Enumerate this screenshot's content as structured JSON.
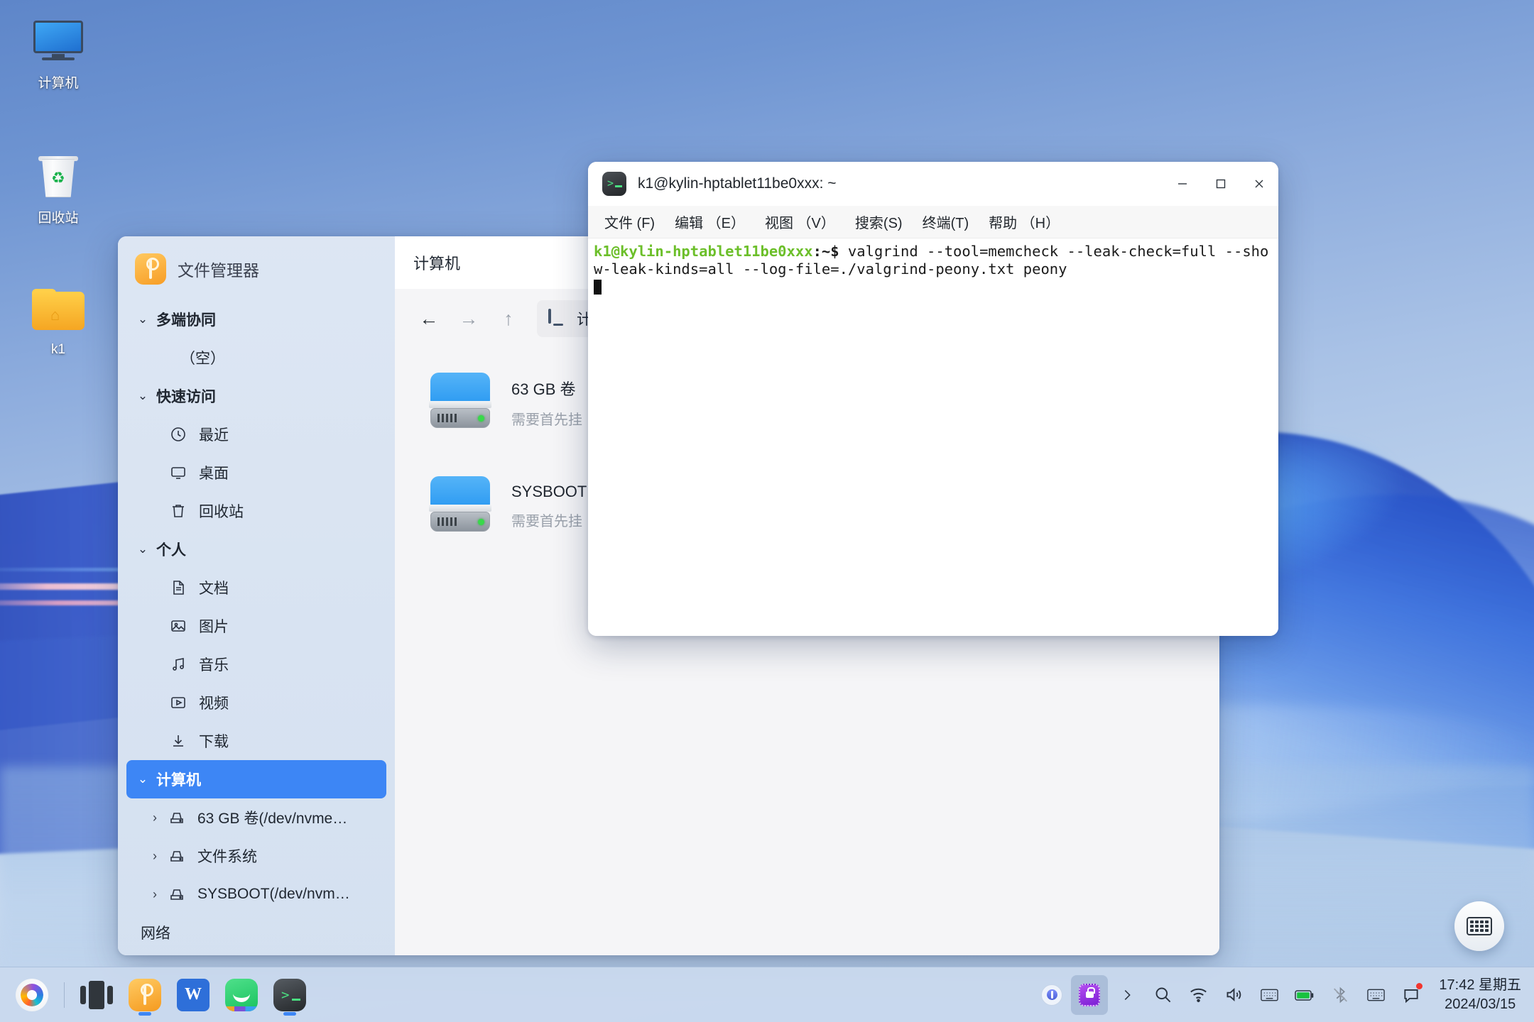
{
  "desktop": {
    "icons": [
      {
        "id": "computer",
        "label": "计算机",
        "icon": "monitor-icon"
      },
      {
        "id": "recycle",
        "label": "回收站",
        "icon": "trash-icon"
      },
      {
        "id": "home",
        "label": "k1",
        "icon": "folder-home-icon"
      }
    ]
  },
  "file_manager": {
    "app_name": "文件管理器",
    "app_icon": "file-manager-icon",
    "tab_title": "计算机",
    "close_label": "✕",
    "toolbar": {
      "back": "←",
      "forward": "→",
      "up": "↑",
      "address_crumb": "计算机",
      "address_icon": "computer-icon"
    },
    "sidebar": {
      "groups": [
        {
          "label": "多端协同",
          "chevron": "⌄",
          "selected": false,
          "items": [
            {
              "label": "（空）",
              "icon": "none",
              "kind": "empty"
            }
          ]
        },
        {
          "label": "快速访问",
          "chevron": "⌄",
          "selected": false,
          "items": [
            {
              "label": "最近",
              "icon": "clock-icon"
            },
            {
              "label": "桌面",
              "icon": "desktop-icon"
            },
            {
              "label": "回收站",
              "icon": "trash-icon"
            }
          ]
        },
        {
          "label": "个人",
          "chevron": "⌄",
          "selected": false,
          "items": [
            {
              "label": "文档",
              "icon": "document-icon"
            },
            {
              "label": "图片",
              "icon": "image-icon"
            },
            {
              "label": "音乐",
              "icon": "music-icon"
            },
            {
              "label": "视频",
              "icon": "video-icon"
            },
            {
              "label": "下载",
              "icon": "download-icon"
            }
          ]
        },
        {
          "label": "计算机",
          "chevron": "⌄",
          "selected": true,
          "drives": [
            {
              "label": "63 GB 卷(/dev/nvme…",
              "icon": "drive-icon",
              "arrow": "›"
            },
            {
              "label": "文件系统",
              "icon": "drive-icon",
              "arrow": "›"
            },
            {
              "label": "SYSBOOT(/dev/nvm…",
              "icon": "drive-icon",
              "arrow": "›"
            }
          ]
        }
      ],
      "network_label": "网络"
    },
    "content": {
      "drives": [
        {
          "name": "63 GB 卷",
          "sub": "需要首先挂",
          "icon": "hdd-icon"
        },
        {
          "name": "SYSBOOT",
          "sub": "需要首先挂",
          "icon": "hdd-icon"
        }
      ]
    }
  },
  "terminal": {
    "title": "k1@kylin-hptablet11be0xxx: ~",
    "icon": "terminal-icon",
    "window_controls": {
      "minimize": "—",
      "maximize": "▢",
      "close": "✕"
    },
    "menus": [
      "文件 (F)",
      "编辑 （E）",
      "视图 （V）",
      "搜索(S)",
      "终端(T)",
      "帮助 （H）"
    ],
    "prompt_user": "k1@kylin-hptablet11be0xxx",
    "prompt_path": ":~$",
    "command": " valgrind --tool=memcheck --leak-check=full --show-leak-kinds=all --log-file=./valgrind-peony.txt peony",
    "colors": {
      "prompt": "#6cbf2a",
      "text": "#1b1b1b",
      "background": "#ffffff"
    }
  },
  "taskbar": {
    "apps": [
      {
        "name": "firefox",
        "icon": "firefox-icon",
        "running": false
      },
      {
        "name": "task-view",
        "icon": "task-view-icon",
        "running": false
      },
      {
        "name": "file-manager",
        "icon": "file-manager-icon",
        "running": true
      },
      {
        "name": "wps",
        "icon": "wps-icon",
        "running": false,
        "letter": "W"
      },
      {
        "name": "wechat",
        "icon": "wechat-icon",
        "running": false
      },
      {
        "name": "terminal",
        "icon": "terminal-icon",
        "running": true
      }
    ],
    "tray": [
      {
        "name": "security-center",
        "icon": "shield-icon",
        "active": false
      },
      {
        "name": "kylin-secure",
        "icon": "secure-lock-icon",
        "active": true
      },
      {
        "name": "tray-expand",
        "icon": "chevron-right-icon",
        "active": false
      },
      {
        "name": "search",
        "icon": "search-icon",
        "active": false
      },
      {
        "name": "wifi",
        "icon": "wifi-icon",
        "active": false
      },
      {
        "name": "volume",
        "icon": "volume-icon",
        "active": false
      },
      {
        "name": "input-method",
        "icon": "keyboard-icon",
        "active": false
      },
      {
        "name": "battery",
        "icon": "battery-icon",
        "active": false
      },
      {
        "name": "bluetooth",
        "icon": "bluetooth-off-icon",
        "active": false
      },
      {
        "name": "onscreen-keyboard",
        "icon": "keyboard-icon",
        "active": false
      },
      {
        "name": "notifications",
        "icon": "message-icon",
        "active": false,
        "badge": true
      }
    ],
    "clock": {
      "time": "17:42 星期五",
      "date": "2024/03/15"
    }
  },
  "floating": {
    "keyboard_button_icon": "keyboard-icon"
  }
}
